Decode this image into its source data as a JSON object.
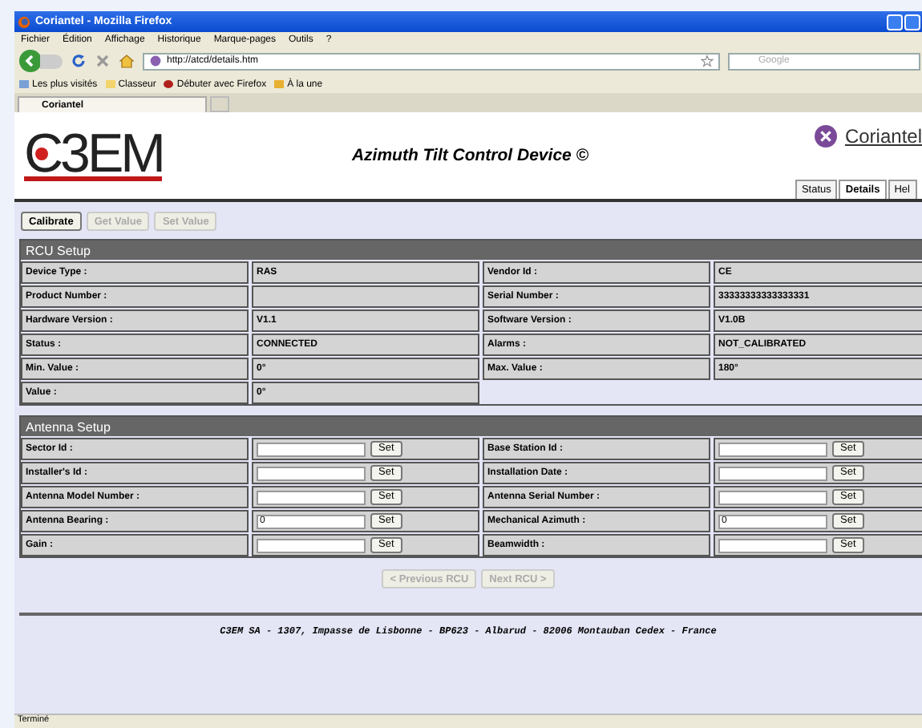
{
  "window": {
    "title": "Coriantel - Mozilla Firefox"
  },
  "menu": [
    "Fichier",
    "Édition",
    "Affichage",
    "Historique",
    "Marque-pages",
    "Outils",
    "?"
  ],
  "address": "http://atcd/details.htm",
  "search": {
    "placeholder": "Google"
  },
  "bookmarks": [
    {
      "label": "Les plus visités",
      "kind": "smart"
    },
    {
      "label": "Classeur",
      "kind": "folder"
    },
    {
      "label": "Débuter avec Firefox",
      "kind": "page"
    },
    {
      "label": "À la une",
      "kind": "feed"
    }
  ],
  "browser_tabs": [
    {
      "label": "Coriantel",
      "selected": true
    }
  ],
  "page": {
    "logo": "C3EM",
    "title": "Azimuth Tilt Control Device ©",
    "brand": "Coriantel",
    "tabs": [
      {
        "label": "Status",
        "selected": false
      },
      {
        "label": "Details",
        "selected": true
      },
      {
        "label": "Hel",
        "selected": false
      }
    ],
    "actions": [
      {
        "label": "Calibrate",
        "disabled": false
      },
      {
        "label": "Get Value",
        "disabled": true
      },
      {
        "label": "Set Value",
        "disabled": true
      }
    ],
    "rcu": {
      "title": "RCU Setup",
      "rows": [
        {
          "label": "Device Type :",
          "value": "RAS",
          "label2": "Vendor Id :",
          "value2": "CE"
        },
        {
          "label": "Product Number :",
          "value": "",
          "label2": "Serial Number :",
          "value2": "33333333333333331"
        },
        {
          "label": "Hardware Version :",
          "value": "V1.1",
          "label2": "Software Version :",
          "value2": "V1.0B"
        },
        {
          "label": "Status :",
          "value": "CONNECTED",
          "label2": "Alarms :",
          "value2": "NOT_CALIBRATED"
        },
        {
          "label": "Min. Value :",
          "value": "0°",
          "label2": "Max. Value :",
          "value2": "180°"
        },
        {
          "label": "Value :",
          "value": "0°"
        }
      ]
    },
    "antenna": {
      "title": "Antenna Setup",
      "rows": [
        {
          "label": "Sector Id :",
          "value": "",
          "button": "Set",
          "label2": "Base Station Id :",
          "value2": "",
          "button2": "Set"
        },
        {
          "label": "Installer's Id :",
          "value": "",
          "button": "Set",
          "label2": "Installation Date :",
          "value2": "",
          "button2": "Set"
        },
        {
          "label": "Antenna Model Number :",
          "value": "",
          "button": "Set",
          "label2": "Antenna Serial Number :",
          "value2": "",
          "button2": "Set"
        },
        {
          "label": "Antenna Bearing :",
          "value": "0",
          "button": "Set",
          "label2": "Mechanical Azimuth :",
          "value2": "0",
          "button2": "Set"
        },
        {
          "label": "Gain :",
          "value": "",
          "button": "Set",
          "label2": "Beamwidth :",
          "value2": "",
          "button2": "Set"
        }
      ]
    },
    "nav": [
      {
        "label": "< Previous RCU",
        "disabled": true
      },
      {
        "label": "Next RCU >",
        "disabled": true
      }
    ],
    "footer": "C3EM SA - 1307, Impasse de Lisbonne - BP623 - Albarud - 82006 Montauban Cedex - France"
  },
  "status_bar": "Terminé"
}
